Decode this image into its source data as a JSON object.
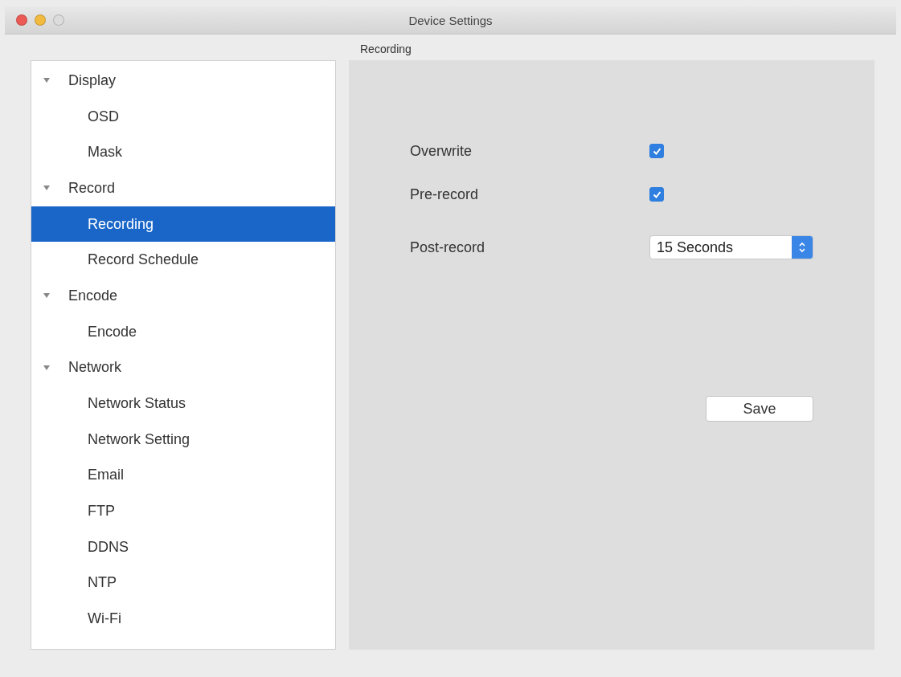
{
  "window": {
    "title": "Device Settings"
  },
  "sidebar": {
    "items": [
      {
        "label": "Display",
        "expanded": true,
        "selected": false,
        "children": [
          {
            "label": "OSD",
            "selected": false
          },
          {
            "label": "Mask",
            "selected": false
          }
        ]
      },
      {
        "label": "Record",
        "expanded": true,
        "selected": false,
        "children": [
          {
            "label": "Recording",
            "selected": true
          },
          {
            "label": "Record Schedule",
            "selected": false
          }
        ]
      },
      {
        "label": "Encode",
        "expanded": true,
        "selected": false,
        "children": [
          {
            "label": "Encode",
            "selected": false
          }
        ]
      },
      {
        "label": "Network",
        "expanded": true,
        "selected": false,
        "children": [
          {
            "label": "Network Status",
            "selected": false
          },
          {
            "label": "Network Setting",
            "selected": false
          },
          {
            "label": "Email",
            "selected": false
          },
          {
            "label": "FTP",
            "selected": false
          },
          {
            "label": "DDNS",
            "selected": false
          },
          {
            "label": "NTP",
            "selected": false
          },
          {
            "label": "Wi-Fi",
            "selected": false
          }
        ]
      }
    ]
  },
  "panel": {
    "title": "Recording",
    "fields": [
      {
        "kind": "checkbox",
        "label": "Overwrite",
        "checked": true
      },
      {
        "kind": "checkbox",
        "label": "Pre-record",
        "checked": true
      },
      {
        "kind": "select",
        "label": "Post-record",
        "value": "15 Seconds"
      }
    ],
    "button": "Save"
  }
}
